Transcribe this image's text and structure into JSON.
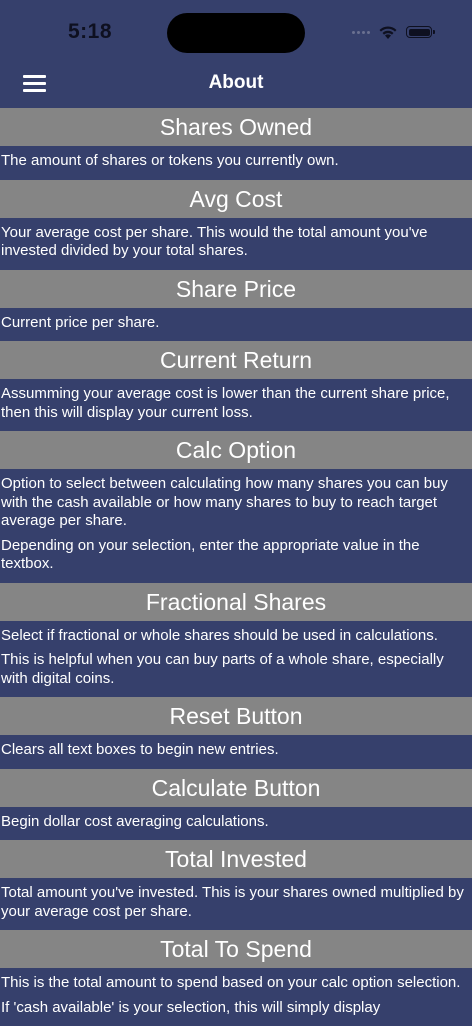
{
  "status_bar": {
    "time": "5:18"
  },
  "nav": {
    "title": "About"
  },
  "sections": [
    {
      "title": "Shares Owned",
      "paragraphs": [
        "The amount of shares or tokens you currently own."
      ]
    },
    {
      "title": "Avg Cost",
      "paragraphs": [
        "Your average cost per share. This would the total amount you've invested divided by your total shares."
      ]
    },
    {
      "title": "Share Price",
      "paragraphs": [
        "Current price per share."
      ]
    },
    {
      "title": "Current Return",
      "paragraphs": [
        "Assumming your average cost is lower than the current share price, then this will display your current loss."
      ]
    },
    {
      "title": "Calc Option",
      "paragraphs": [
        "Option to select between calculating how many shares you can buy with the cash available or how many shares to buy to reach target average per share.",
        "Depending on your selection, enter the appropriate value in the textbox."
      ]
    },
    {
      "title": "Fractional Shares",
      "paragraphs": [
        "Select if fractional or whole shares should be used in calculations.",
        "This is helpful when you can buy parts of a whole share, especially with digital coins."
      ]
    },
    {
      "title": "Reset Button",
      "paragraphs": [
        "Clears all text boxes to begin new entries."
      ]
    },
    {
      "title": "Calculate Button",
      "paragraphs": [
        "Begin dollar cost averaging calculations."
      ]
    },
    {
      "title": "Total Invested",
      "paragraphs": [
        "Total amount you've invested. This is your shares owned multiplied by your average cost per share."
      ]
    },
    {
      "title": "Total To Spend",
      "paragraphs": [
        "This is the total amount to spend based on your calc option selection.",
        "If 'cash available' is your selection, this will simply display"
      ]
    }
  ]
}
